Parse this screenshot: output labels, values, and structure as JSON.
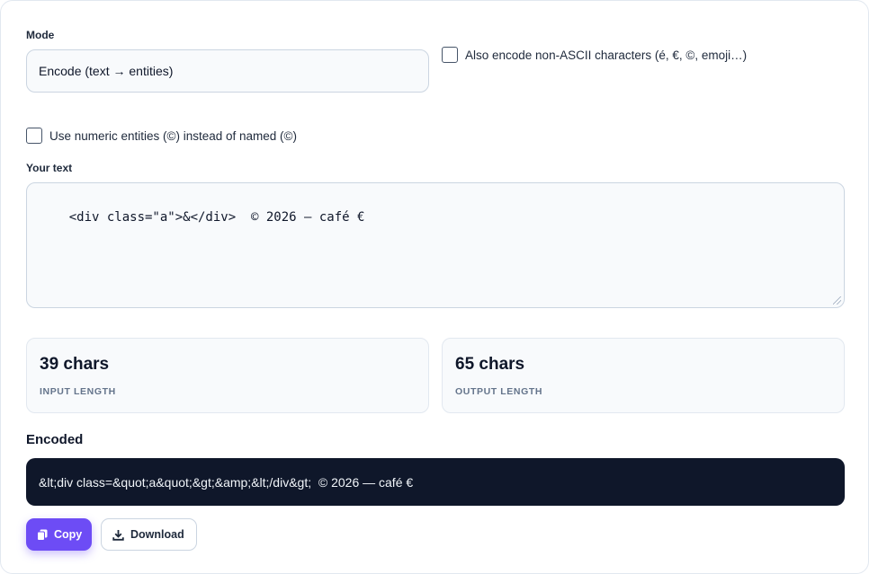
{
  "mode": {
    "label": "Mode",
    "selected": "Encode (text → entities)"
  },
  "options": {
    "non_ascii_label": "Also encode non-ASCII characters (é, €, ©, emoji…)",
    "non_ascii_checked": false,
    "numeric_label": "Use numeric entities (©) instead of named (©)",
    "numeric_checked": false
  },
  "input": {
    "label": "Your text",
    "value": "<div class=\"a\">&</div>  © 2026 — café €"
  },
  "stats": {
    "input_value": "39 chars",
    "input_label": "INPUT LENGTH",
    "output_value": "65 chars",
    "output_label": "OUTPUT LENGTH"
  },
  "output": {
    "title": "Encoded",
    "value": "&lt;div class=&quot;a&quot;&gt;&amp;&lt;/div&gt;  © 2026 — café €"
  },
  "actions": {
    "copy_label": "Copy",
    "copy_icon": "copy-icon",
    "download_label": "Download",
    "download_icon": "download-icon"
  },
  "colors": {
    "accent": "#6d4cf5",
    "output_bg": "#0f172a",
    "field_bg": "#f8fafc",
    "muted_text": "#64748b"
  }
}
